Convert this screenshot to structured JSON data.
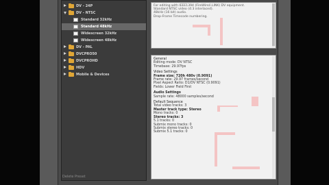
{
  "tree": {
    "items": [
      {
        "label": "DV - 24P",
        "level": 0,
        "type": "folder",
        "expanded": false,
        "selected": false
      },
      {
        "label": "DV - NTSC",
        "level": 0,
        "type": "folder",
        "expanded": true,
        "selected": false
      },
      {
        "label": "Standard 32kHz",
        "level": 1,
        "type": "preset",
        "selected": false
      },
      {
        "label": "Standard 48kHz",
        "level": 1,
        "type": "preset",
        "selected": true
      },
      {
        "label": "Widescreen 32kHz",
        "level": 1,
        "type": "preset",
        "selected": false
      },
      {
        "label": "Widescreen 48kHz",
        "level": 1,
        "type": "preset",
        "selected": false
      },
      {
        "label": "DV - PAL",
        "level": 0,
        "type": "folder",
        "expanded": false,
        "selected": false
      },
      {
        "label": "DVCPRO50",
        "level": 0,
        "type": "folder",
        "expanded": false,
        "selected": false
      },
      {
        "label": "DVCPROHD",
        "level": 0,
        "type": "folder",
        "expanded": false,
        "selected": false
      },
      {
        "label": "HDV",
        "level": 0,
        "type": "folder",
        "expanded": false,
        "selected": false
      },
      {
        "label": "Mobile & Devices",
        "level": 0,
        "type": "folder",
        "expanded": false,
        "selected": false
      }
    ]
  },
  "footer": {
    "label": "Delete Preset"
  },
  "description": {
    "lines": [
      "For editing with IEEE1394 (FireWire/i.LINK) DV equipment.",
      "Standard NTSC video (4:3 interlaced).",
      "48kHz (16 bit) audio.",
      "Drop-Frame Timecode numbering."
    ]
  },
  "general": {
    "section_general": "General",
    "editing_mode": "Editing mode: DV NTSC",
    "timebase": "Timebase: 29.97fps",
    "section_video": "Video Settings",
    "frame_size": "Frame size: 720h 480v (0.9091)",
    "frame_rate": "Frame rate: 29.97 frames/second",
    "pixel_aspect": "Pixel Aspect Ratio: D1/DV NTSC (0.9091)",
    "fields": "Fields: Lower Field First",
    "section_audio": "Audio Settings",
    "sample_rate": "Sample rate: 48000 samples/second",
    "section_default": "Default Sequence",
    "video_tracks": "Total video tracks: 3",
    "master_track": "Master track type: Stereo",
    "mono_tracks": "Mono tracks: 0",
    "stereo_tracks": "Stereo tracks: 3",
    "tracks_51": "5.1 tracks: 0",
    "submix_mono": "Submix mono tracks: 0",
    "submix_stereo": "Submix stereo tracks: 0",
    "submix_51": "Submix 5.1 tracks: 0"
  }
}
